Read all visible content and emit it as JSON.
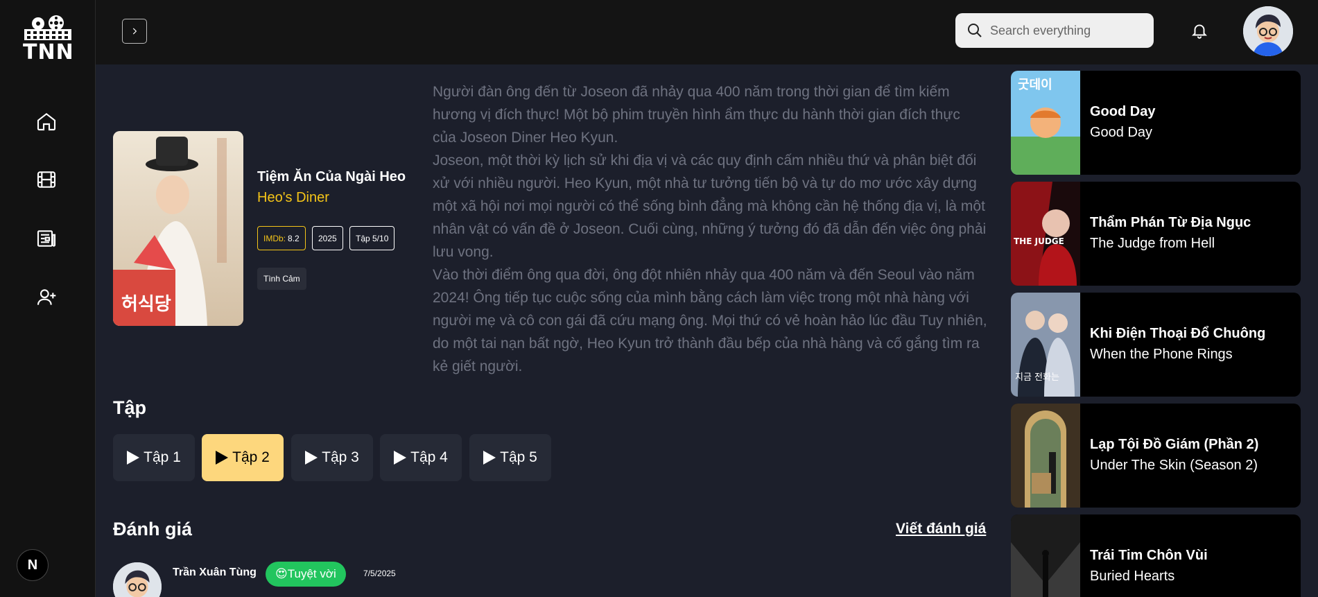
{
  "brand": {
    "logo_text": "TNN",
    "logo_badge": "N"
  },
  "header": {
    "search_placeholder": "Search everything"
  },
  "sidebar": {
    "items": [
      "home-icon",
      "film-icon",
      "news-icon",
      "add-user-icon"
    ]
  },
  "movie": {
    "title_vi": "Tiệm Ăn Của Ngài Heo",
    "title_en": "Heo's Diner",
    "imdb_label": "IMDb:",
    "imdb_score": "8.2",
    "year": "2025",
    "episode_progress": "Tập 5/10",
    "genre": "Tình Cảm",
    "description": [
      "Người đàn ông đến từ Joseon đã nhảy qua 400 năm trong thời gian để tìm kiếm hương vị đích thực! Một bộ phim truyền hình ẩm thực du hành thời gian đích thực của Joseon Diner Heo Kyun.",
      "Joseon, một thời kỳ lịch sử khi địa vị và các quy định cấm nhiều thứ và phân biệt đối xử với nhiều người. Heo Kyun, một nhà tư tưởng tiến bộ và tự do mơ ước xây dựng một xã hội nơi mọi người có thể sống bình đẳng mà không cần hệ thống địa vị, là một nhân vật có vấn đề ở Joseon. Cuối cùng, những ý tưởng đó đã dẫn đến việc ông phải lưu vong.",
      "Vào thời điểm ông qua đời, ông đột nhiên nhảy qua 400 năm và đến Seoul vào năm 2024! Ông tiếp tục cuộc sống của mình bằng cách làm việc trong một nhà hàng với người mẹ và cô con gái đã cứu mạng ông. Mọi thứ có vẻ hoàn hảo lúc đầu Tuy nhiên, do một tai nạn bất ngờ, Heo Kyun trở thành đầu bếp của nhà hàng và cố gắng tìm ra kẻ giết người."
    ]
  },
  "episodes": {
    "title": "Tập",
    "items": [
      "Tập 1",
      "Tập 2",
      "Tập 3",
      "Tập 4",
      "Tập 5"
    ],
    "active": "Tập 2"
  },
  "reviews": {
    "title": "Đánh giá",
    "write_label": "Viết đánh giá",
    "first": {
      "name": "Trần Xuân Tùng",
      "rating_emoji": "😍",
      "rating": "Tuyệt vời",
      "date": "7/5/2025"
    }
  },
  "related": [
    {
      "title": "Good Day",
      "subtitle": "Good Day",
      "accent": "#6fb7e6"
    },
    {
      "title": "Thẩm Phán Từ Địa Ngục",
      "subtitle": "The Judge from Hell",
      "accent": "#a4161a"
    },
    {
      "title": "Khi Điện Thoại Đổ Chuông",
      "subtitle": "When the Phone Rings",
      "accent": "#5a6b86"
    },
    {
      "title": "Lạp Tội Đồ Giám (Phần 2)",
      "subtitle": "Under The Skin (Season 2)",
      "accent": "#6b5232"
    },
    {
      "title": "Trái Tim Chôn Vùi",
      "subtitle": "Buried Hearts",
      "accent": "#2b2b2b"
    }
  ]
}
